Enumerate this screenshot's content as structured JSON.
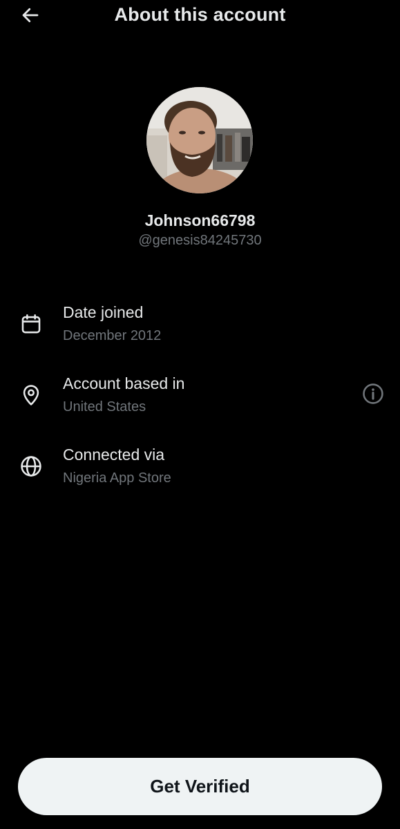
{
  "header": {
    "title": "About this account",
    "back_icon": "arrow-left-icon"
  },
  "profile": {
    "display_name": "Johnson66798",
    "handle": "@genesis84245730"
  },
  "info_rows": [
    {
      "icon": "calendar-icon",
      "label": "Date joined",
      "value": "December 2012"
    },
    {
      "icon": "location-pin-icon",
      "label": "Account based in",
      "value": "United States",
      "trailing_icon": "info-circle-icon"
    },
    {
      "icon": "globe-icon",
      "label": "Connected via",
      "value": "Nigeria App Store"
    }
  ],
  "footer": {
    "button_label": "Get Verified"
  },
  "colors": {
    "background": "#000000",
    "primary_text": "#e7e9ea",
    "secondary_text": "#71767b",
    "button_bg": "#eff3f4",
    "button_text": "#0f1419"
  }
}
